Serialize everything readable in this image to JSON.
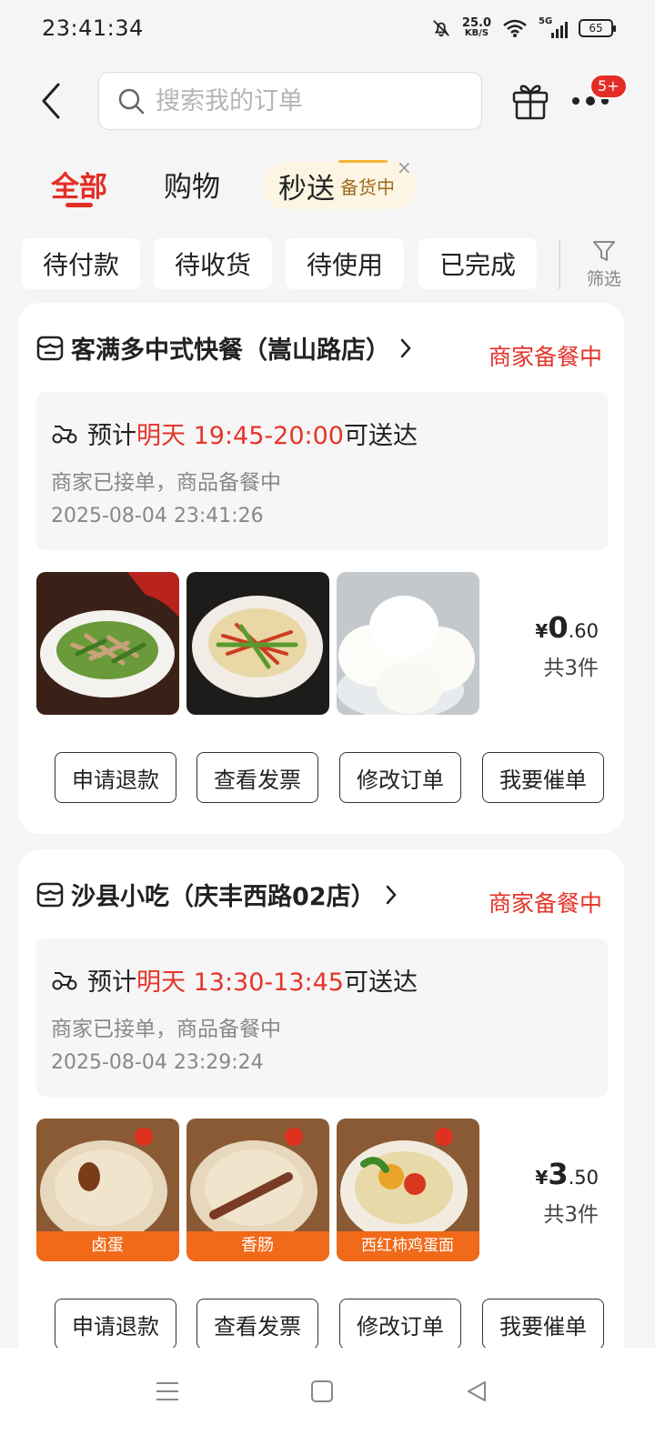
{
  "status_bar": {
    "time": "23:41:34",
    "net_speed": "25.0",
    "net_unit": "KB/S",
    "signal": "5G",
    "battery": "65"
  },
  "header": {
    "search_placeholder": "搜索我的订单",
    "badge": "5+"
  },
  "category_tabs": [
    {
      "label": "全部",
      "active": true
    },
    {
      "label": "购物"
    }
  ],
  "miaosong": {
    "label": "秒送",
    "status": "备货中",
    "close": "×"
  },
  "filters": [
    "待付款",
    "待收货",
    "待使用",
    "已完成"
  ],
  "filter_button": "筛选",
  "orders": [
    {
      "store": "客满多中式快餐（嵩山路店）",
      "status": "商家备餐中",
      "eta_prefix": "预计",
      "eta_time": "明天 19:45-20:00",
      "eta_suffix": "可送达",
      "desc": "商家已接单，商品备餐中",
      "time": "2025-08-04 23:41:26",
      "items": [
        {
          "icon": "pork-pepper-stirfry-image"
        },
        {
          "icon": "tofu-skin-stirfry-image"
        },
        {
          "icon": "steamed-buns-image"
        }
      ],
      "price_currency": "¥",
      "price_int": "0",
      "price_dec": ".60",
      "count": "共3件",
      "actions": [
        "申请退款",
        "查看发票",
        "修改订单",
        "我要催单"
      ]
    },
    {
      "store": "沙县小吃（庆丰西路02店）",
      "status": "商家备餐中",
      "eta_prefix": "预计",
      "eta_time": "明天 13:30-13:45",
      "eta_suffix": "可送达",
      "desc": "商家已接单，商品备餐中",
      "time": "2025-08-04 23:29:24",
      "items": [
        {
          "label": "卤蛋",
          "icon": "braised-egg-image"
        },
        {
          "label": "香肠",
          "icon": "sausage-image"
        },
        {
          "label": "西红柿鸡蛋面",
          "icon": "tomato-egg-noodle-image"
        }
      ],
      "price_currency": "¥",
      "price_int": "3",
      "price_dec": ".50",
      "count": "共3件",
      "actions": [
        "申请退款",
        "查看发票",
        "修改订单",
        "我要催单"
      ]
    }
  ]
}
